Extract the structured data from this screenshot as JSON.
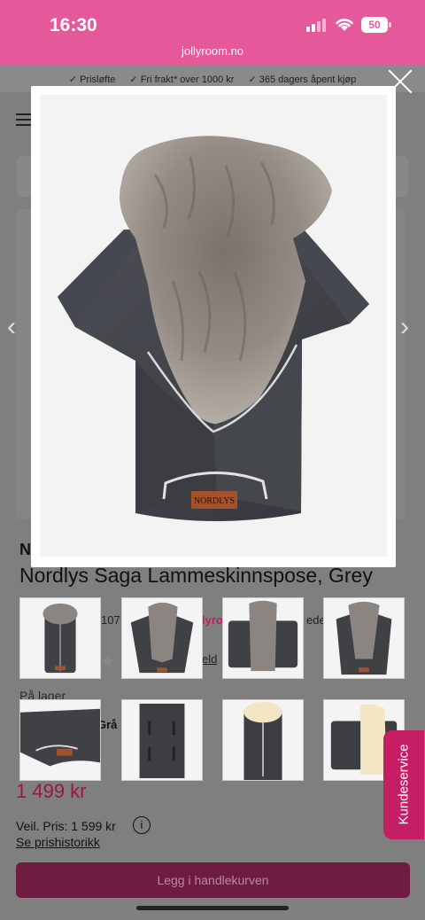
{
  "status_bar": {
    "time": "16:30",
    "battery": "50",
    "url": "jollyroom.no"
  },
  "usp_bar": [
    "Prisløfte",
    "Fri frakt* over 1000 kr",
    "365 dagers åpent kjøp"
  ],
  "product": {
    "brand_partial": "N",
    "title": "Nordlys Saga Lammeskinnspose, Grey",
    "rating_fragment": "107",
    "reviews_fragment": "eld",
    "partner_fragment": "lyro",
    "partner_fragment_2": "eder",
    "stock": "På lager",
    "color_fragment": "Grå",
    "price": "1 499 kr",
    "list_price": "Veil. Pris: 1 599 kr",
    "price_history": "Se prishistorikk",
    "cart_button": "Legg i handlekurven"
  },
  "modal": {
    "logo_text": "NORDLYS"
  },
  "support_tab": "Kundeservice",
  "icons": {
    "info": "i",
    "prev": "‹",
    "next": "›"
  },
  "colors": {
    "status_pink": "#e5589a",
    "price": "#a3114a",
    "support": "#c51e64",
    "cart": "#6e1d41"
  }
}
